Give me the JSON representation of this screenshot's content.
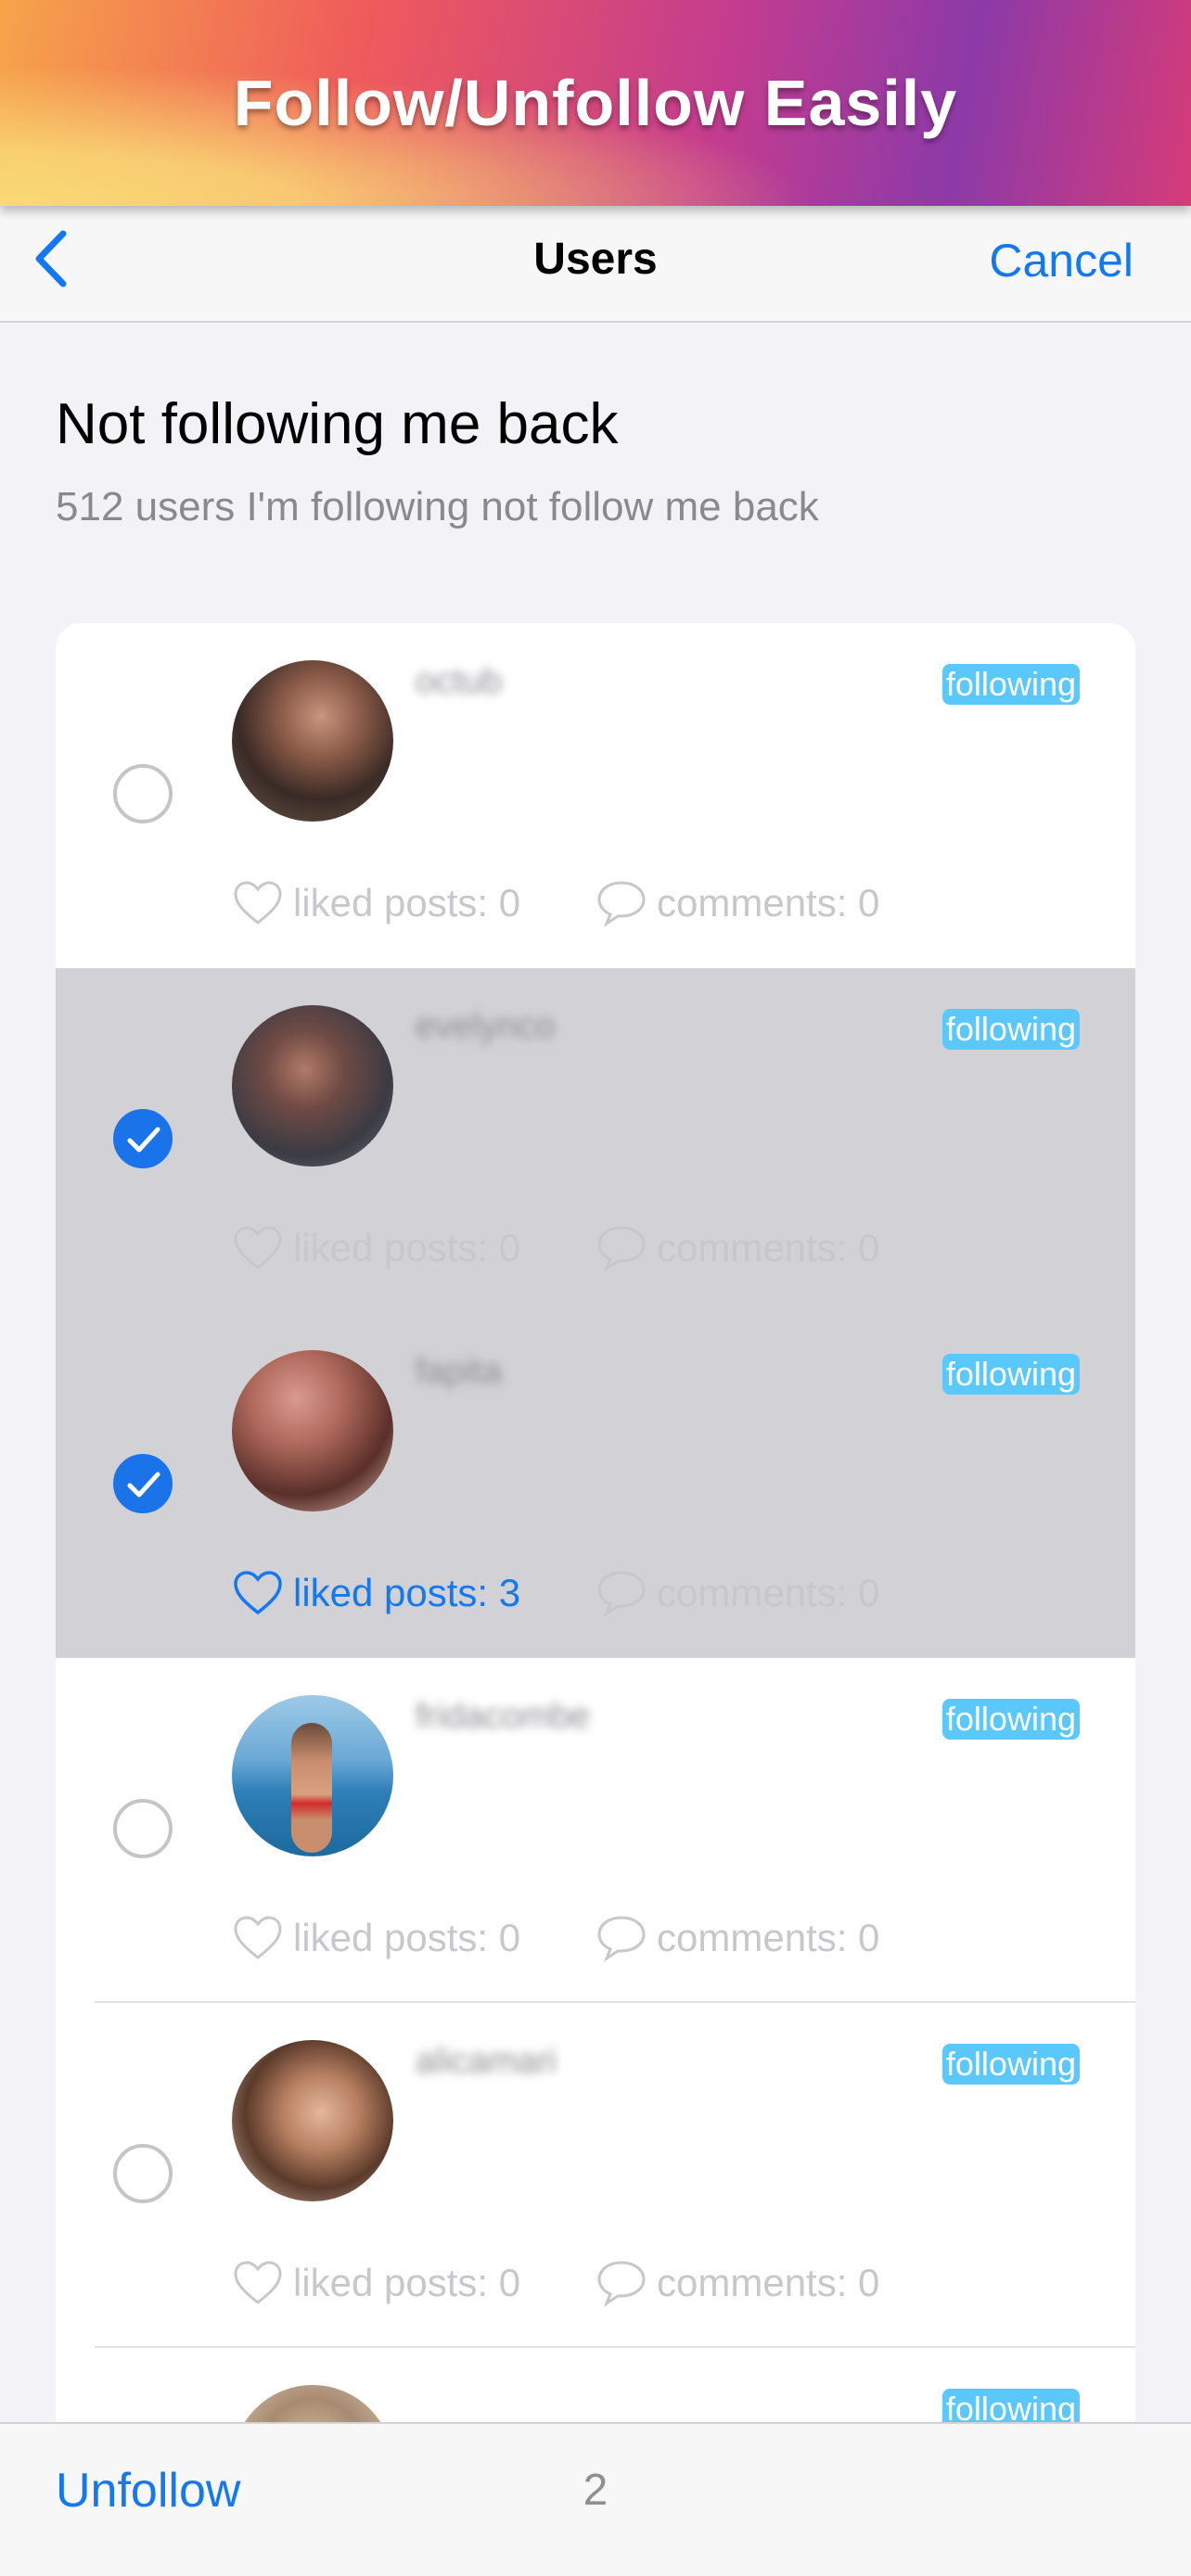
{
  "banner": {
    "title": "Follow/Unfollow Easily"
  },
  "navbar": {
    "title": "Users",
    "cancel_label": "Cancel"
  },
  "section": {
    "title": "Not following me back",
    "subtitle": "512 users I'm following not follow me back"
  },
  "users": [
    {
      "username": "octub",
      "badge": "following",
      "likes_label": "liked posts: 0",
      "comments_label": "comments: 0",
      "selected": false
    },
    {
      "username": "evelynco",
      "badge": "following",
      "likes_label": "liked posts: 0",
      "comments_label": "comments: 0",
      "selected": true
    },
    {
      "username": "fapita",
      "badge": "following",
      "likes_label": "liked posts: 3",
      "comments_label": "comments: 0",
      "selected": true
    },
    {
      "username": "fridacombe",
      "badge": "following",
      "likes_label": "liked posts: 0",
      "comments_label": "comments: 0",
      "selected": false
    },
    {
      "username": "alicamari",
      "badge": "following",
      "likes_label": "liked posts: 0",
      "comments_label": "comments: 0",
      "selected": false
    },
    {
      "username": "",
      "badge": "following",
      "likes_label": "",
      "comments_label": "",
      "selected": false
    }
  ],
  "toolbar": {
    "unfollow_label": "Unfollow",
    "selected_count": "2"
  },
  "colors": {
    "accent": "#1479f1",
    "badge": "#5ac8fa",
    "selected_row": "#d1d1d6"
  }
}
